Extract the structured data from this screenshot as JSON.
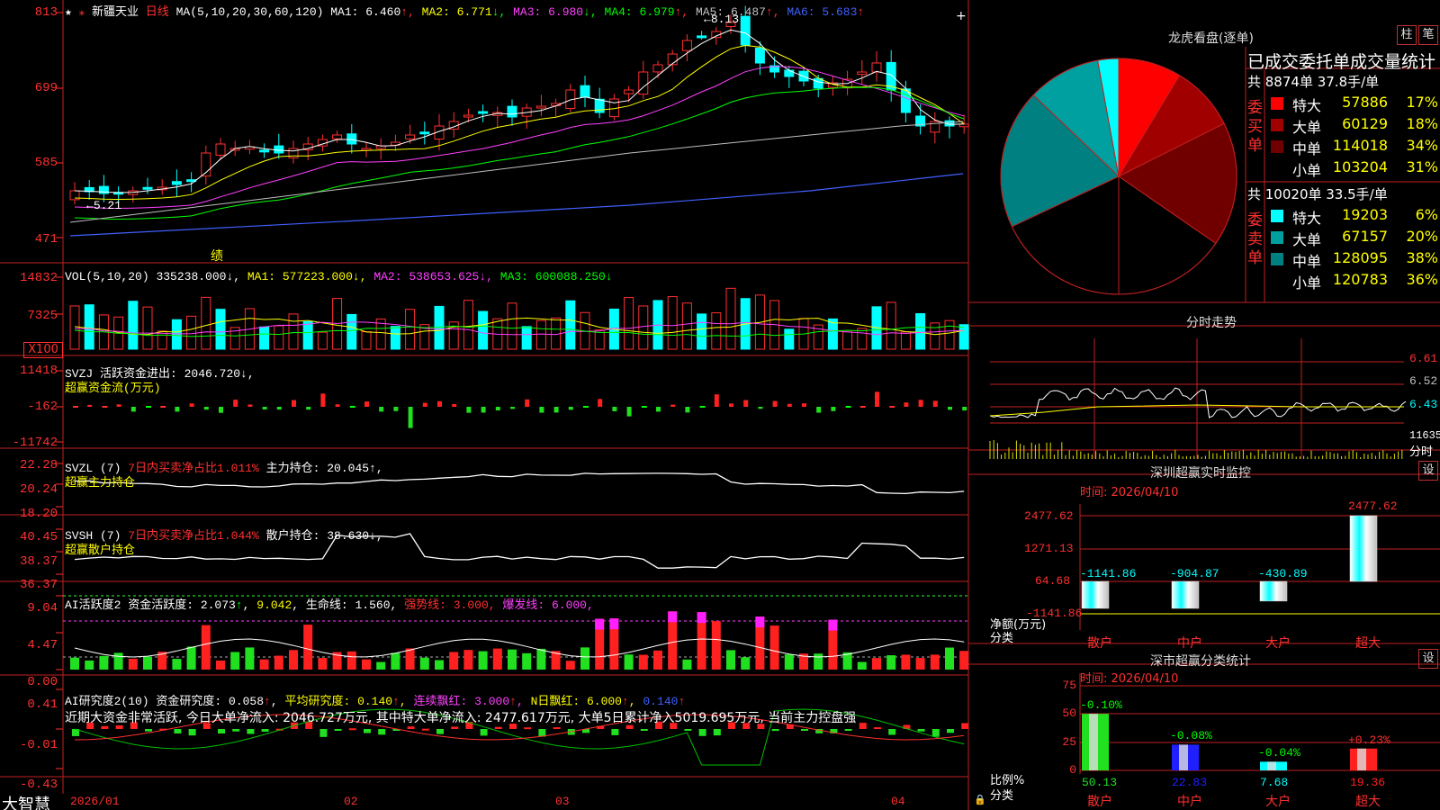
{
  "app": {
    "brand": "大智慧"
  },
  "price": {
    "ticks": [
      "813",
      "699",
      "585",
      "471"
    ],
    "star": "★",
    "stock_name": "新疆天业",
    "period": "日线",
    "ma_title": "MA(5,10,20,30,60,120)",
    "ma": [
      {
        "label": "MA1: 6.460",
        "arrow": "↑",
        "color": "#ffffff"
      },
      {
        "label": "MA2: 6.771",
        "arrow": "↓",
        "color": "#ffff00"
      },
      {
        "label": "MA3: 6.980",
        "arrow": "↓",
        "color": "#ff40ff"
      },
      {
        "label": "MA4: 6.979",
        "arrow": "↑",
        "color": "#00ff00"
      },
      {
        "label": "MA5: 6.487",
        "arrow": "↑",
        "color": "#c0c0c0"
      },
      {
        "label": "MA6: 5.683",
        "arrow": "↑",
        "color": "#4060ff"
      }
    ],
    "high_mark": "8.13",
    "low_mark": "5.21",
    "event_mark": "绩"
  },
  "vol": {
    "ticks": [
      "14832",
      "7325",
      "X100"
    ],
    "title": "VOL(5,10,20)",
    "value": "335238.000",
    "ma1": "MA1: 577223.000",
    "ma2": "MA2: 538653.625",
    "ma3": "MA3: 600088.250"
  },
  "svzj": {
    "ticks": [
      "11418",
      "-162",
      "-11742"
    ],
    "title": "SVZJ",
    "line1": "活跃资金进出: 2046.720",
    "line2": "超赢资金流(万元)"
  },
  "svzl": {
    "ticks": [
      "22.28",
      "20.24",
      "18.20"
    ],
    "title": "SVZL (7)",
    "ratio": "7日内买卖净占比1.011%",
    "hold": "主力持仓: 20.045",
    "line2": "超赢主力持仓"
  },
  "svsh": {
    "ticks": [
      "40.45",
      "38.37",
      "36.37"
    ],
    "title": "SVSH (7)",
    "ratio": "7日内买卖净占比1.044%",
    "hold": "散户持仓: 38.630",
    "line2": "超赢散户持仓"
  },
  "ai2": {
    "ticks": [
      "9.04",
      "4.47",
      "0.00"
    ],
    "title": "AI活跃度2",
    "act": "资金活跃度: 2.073",
    "v2": "9.042",
    "life": "生命线: 1.560",
    "strong": "强势线: 3.000",
    "burst": "爆发线: 6.000"
  },
  "ai_res": {
    "ticks": [
      "0.41",
      "-0.01",
      "-0.43"
    ],
    "title": "AI研究度2(10)",
    "res": "资金研究度: 0.058",
    "avg": "平均研究度: 0.140",
    "cont": "连续飘红: 3.000",
    "n": "N日飘红: 6.000",
    "v5": "0.140",
    "comment": "近期大资金非常活跃, 今日大单净流入: 2046.727万元, 其中特大单净流入: 2477.617万元, 大单5日累计净入5019.695万元, 当前主力控盘强"
  },
  "x_axis": [
    "2026/01",
    "02",
    "03",
    "04"
  ],
  "lhb": {
    "title": "龙虎看盘(逐单)",
    "btn_bar": "柱",
    "btn_pen": "笔",
    "table_title": "已成交委托单成交量统计",
    "buy": {
      "side_label": "委买单",
      "summary": "共 8874单 37.8手/单",
      "rows": [
        {
          "name": "特大",
          "val": "57886",
          "pct": "17%",
          "color": "#ff0000"
        },
        {
          "name": "大单",
          "val": "60129",
          "pct": "18%",
          "color": "#a00000"
        },
        {
          "name": "中单",
          "val": "114018",
          "pct": "34%",
          "color": "#700000"
        },
        {
          "name": "小单",
          "val": "103204",
          "pct": "31%",
          "color": "#000000"
        }
      ]
    },
    "sell": {
      "side_label": "委卖单",
      "summary": "共 10020单 33.5手/单",
      "rows": [
        {
          "name": "特大",
          "val": "19203",
          "pct": "6%",
          "color": "#00ffff"
        },
        {
          "name": "大单",
          "val": "67157",
          "pct": "20%",
          "color": "#00a0a0"
        },
        {
          "name": "中单",
          "val": "128095",
          "pct": "38%",
          "color": "#008080"
        },
        {
          "name": "小单",
          "val": "120783",
          "pct": "36%",
          "color": "#000000"
        }
      ]
    }
  },
  "fenshi": {
    "title": "分时走势",
    "ticks": [
      "6.61",
      "6.52",
      "6.43"
    ],
    "vol_tick": "11635",
    "vol_label": "分时"
  },
  "monitor": {
    "title": "深圳超赢实时监控",
    "btn": "设",
    "time": "时间: 2026/04/10",
    "ticks": [
      "2477.62",
      "1271.13",
      "64.68",
      "-1141.86"
    ],
    "yaxis": "净额(万元)",
    "cat_label": "分类",
    "bars": [
      {
        "cat": "散户",
        "value": -1141.86,
        "label": "-1141.86"
      },
      {
        "cat": "中户",
        "value": -904.87,
        "label": "-904.87"
      },
      {
        "cat": "大户",
        "value": -430.89,
        "label": "-430.89"
      },
      {
        "cat": "超大",
        "value": 2477.62,
        "label": "2477.62"
      }
    ]
  },
  "classify": {
    "title": "深市超赢分类统计",
    "btn": "设",
    "time": "时间: 2026/04/10",
    "ticks": [
      "75",
      "50",
      "25",
      "0"
    ],
    "yaxis": "比例%",
    "cat_label": "分类",
    "bars": [
      {
        "cat": "散户",
        "value": 50.13,
        "label": "50.13",
        "chg": "-0.10%"
      },
      {
        "cat": "中户",
        "value": 22.83,
        "label": "22.83",
        "chg": "-0.08%"
      },
      {
        "cat": "大户",
        "value": 7.68,
        "label": "7.68",
        "chg": "-0.04%"
      },
      {
        "cat": "超大",
        "value": 19.36,
        "label": "19.36",
        "chg": "+0.23%"
      }
    ]
  },
  "chart_data": [
    {
      "type": "pie",
      "title": "龙虎看盘(逐单)",
      "categories": [
        "委买特大",
        "委买大单",
        "委买中单",
        "委买小单",
        "委卖特大",
        "委卖大单",
        "委卖中单",
        "委卖小单"
      ],
      "values": [
        57886,
        60129,
        114018,
        103204,
        19203,
        67157,
        128095,
        120783
      ]
    },
    {
      "type": "bar",
      "title": "深圳超赢实时监控",
      "categories": [
        "散户",
        "中户",
        "大户",
        "超大"
      ],
      "values": [
        -1141.86,
        -904.87,
        -430.89,
        2477.62
      ],
      "ylabel": "净额(万元)",
      "ylim": [
        -1141.86,
        2477.62
      ]
    },
    {
      "type": "bar",
      "title": "深市超赢分类统计",
      "categories": [
        "散户",
        "中户",
        "大户",
        "超大"
      ],
      "values": [
        50.13,
        22.83,
        7.68,
        19.36
      ],
      "ylabel": "比例%",
      "ylim": [
        0,
        75
      ]
    }
  ]
}
